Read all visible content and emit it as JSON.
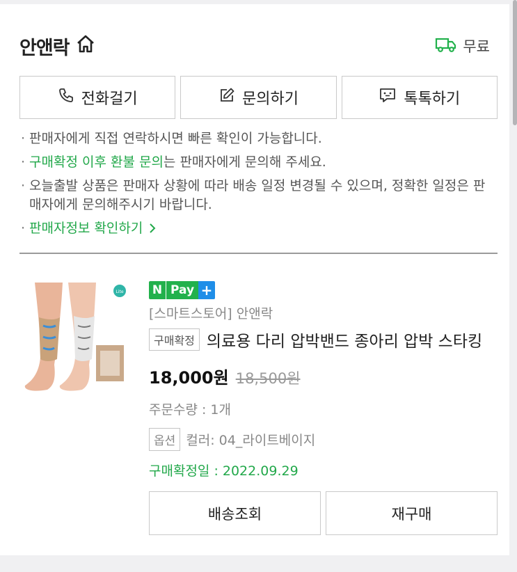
{
  "store": {
    "name": "안앤락",
    "home_icon": "home-icon",
    "shipping_label": "무료",
    "shipping_icon": "truck-icon"
  },
  "actions": [
    {
      "label": "전화걸기",
      "icon": "phone-icon"
    },
    {
      "label": "문의하기",
      "icon": "pencil-note-icon"
    },
    {
      "label": "톡톡하기",
      "icon": "chat-icon"
    }
  ],
  "notes": {
    "line1": "판매자에게 직접 연락하시면 빠른 확인이 가능합니다.",
    "line2_green": "구매확정 이후 환불 문의",
    "line2_rest": "는 판매자에게 문의해 주세요.",
    "line3": "오늘출발 상품은 판매자 상황에 따라 배송 일정 변경될 수 있으며, 정확한 일정은 판매자에게 문의해주시기 바랍니다.",
    "line4_link": "판매자정보 확인하기"
  },
  "product": {
    "npay_n": "N",
    "npay_pay": "Pay",
    "npay_plus": "+",
    "store_line": "[스마트스토어] 안앤락",
    "status_tag": "구매확정",
    "title": "의료용 다리 압박밴드 종아리 압박 스타킹",
    "price": "18,000원",
    "original_price": "18,500원",
    "quantity": "주문수량 : 1개",
    "option_tag": "옵션",
    "option_text": "컬러: 04_라이트베이지",
    "confirm_date": "구매확정일 : 2022.09.29"
  },
  "bottom_buttons": {
    "track": "배송조회",
    "rebuy": "재구매"
  },
  "colors": {
    "green": "#22a84a",
    "npay_green": "#22b14c",
    "npay_blue": "#1f8ee8"
  }
}
